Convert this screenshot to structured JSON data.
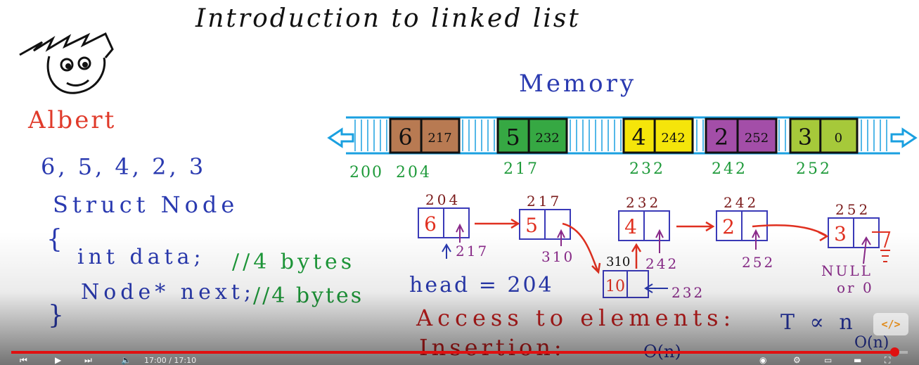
{
  "title": "Introduction to linked list",
  "student_name": "Albert",
  "values_list": "6, 5, 4, 2, 3",
  "code": {
    "struct_line": "Struct Node",
    "open_brace": "{",
    "data_line": "int data;",
    "data_comment": "//4 bytes",
    "next_line": "Node* next;",
    "next_comment": "//4 bytes",
    "close_brace": "}"
  },
  "memory": {
    "label": "Memory",
    "blocks": [
      {
        "data": "6",
        "next": "217",
        "address": "204",
        "color": "#b87a52"
      },
      {
        "data": "5",
        "next": "232",
        "address": "217",
        "color": "#36a843"
      },
      {
        "data": "4",
        "next": "242",
        "address": "232",
        "color": "#f5e50a"
      },
      {
        "data": "2",
        "next": "252",
        "address": "242",
        "color": "#a34ea8"
      },
      {
        "data": "3",
        "next": "0",
        "address": "252",
        "color": "#a6c93a"
      }
    ],
    "start_address": "200",
    "bar_color": "#1aa0e0"
  },
  "diagram": {
    "nodes": [
      {
        "address": "204",
        "data": "6",
        "pointer_note": "217"
      },
      {
        "address": "217",
        "data": "5",
        "pointer_note": "310"
      },
      {
        "address": "232",
        "data": "4",
        "pointer_note": "242"
      },
      {
        "address": "242",
        "data": "2",
        "pointer_note": "252"
      },
      {
        "address": "252",
        "data": "3",
        "pointer_note": "NULL or 0"
      }
    ],
    "inserted_node": {
      "address": "310",
      "data": "10",
      "pointer_note": "232"
    },
    "head_text": "head = 204"
  },
  "notes": {
    "access": "Access to elements:",
    "access_formula": "T ∝ n",
    "access_complexity": "O(n)",
    "insertion": "Insertion:",
    "insertion_complexity": "O(n)"
  },
  "player": {
    "time": "17:00 / 17:10",
    "progress": 0.985,
    "progress_color": "#e01010",
    "corner_badge": "</>"
  },
  "colors": {
    "title": "#111111",
    "name": "#e03a2a",
    "code_blue": "#2a3ab0",
    "comment_green": "#1e9a3a",
    "address_green": "#1e9a3a",
    "node_box": "#3a3ab8",
    "node_data": "#e03020",
    "arrow_red": "#e03020",
    "pointer_purple": "#8a2a8a",
    "address_dark_red": "#7a1a1a",
    "notes_red": "#d02020"
  }
}
